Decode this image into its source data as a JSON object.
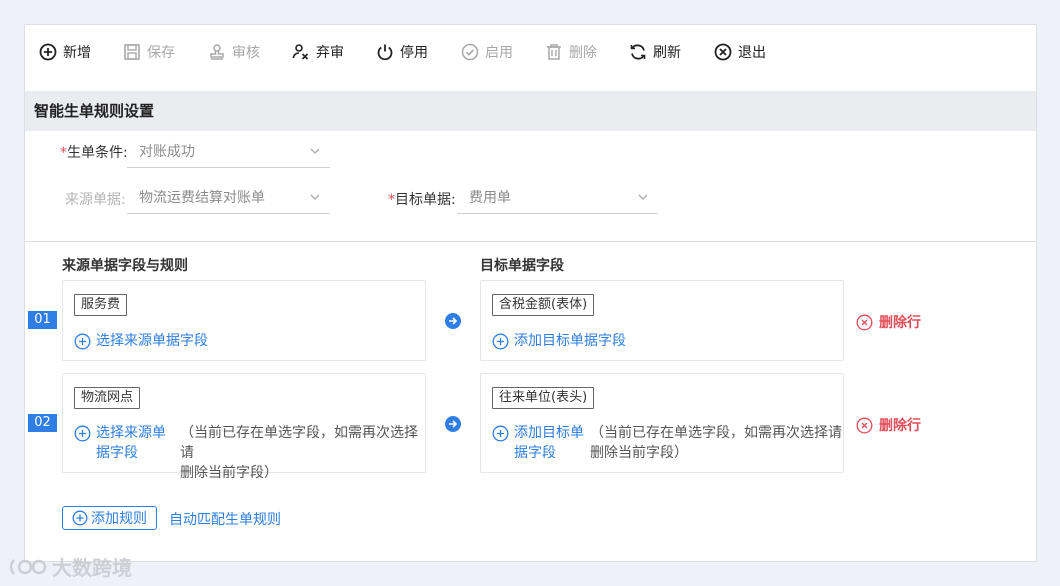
{
  "toolbar": {
    "add": "新增",
    "save": "保存",
    "audit": "审核",
    "unaudit": "弃审",
    "disable": "停用",
    "enable": "启用",
    "delete": "删除",
    "refresh": "刷新",
    "exit": "退出"
  },
  "section": {
    "title": "智能生单规则设置"
  },
  "form": {
    "condition_label": "生单条件:",
    "condition_value": "对账成功",
    "source_label": "来源单据:",
    "source_value": "物流运费结算对账单",
    "target_label": "目标单据:",
    "target_value": "费用单"
  },
  "columns": {
    "source": "来源单据字段与规则",
    "target": "目标单据字段"
  },
  "rows": [
    {
      "num": "01",
      "source_tag": "服务费",
      "source_add": "选择来源单据字段",
      "target_tag": "含税金额(表体)",
      "target_add": "添加目标单据字段",
      "delete": "删除行"
    },
    {
      "num": "02",
      "source_tag": "物流网点",
      "source_add_1": "选择来源单",
      "source_add_2": "据字段",
      "source_hint_1": "（当前已存在单选字段，如需再次选择请",
      "source_hint_2": "删除当前字段）",
      "target_tag": "往来单位(表头)",
      "target_add_1": "添加目标单",
      "target_add_2": "据字段",
      "target_hint_1": "（当前已存在单选字段，如需再次选择请",
      "target_hint_2": "删除当前字段）",
      "delete": "删除行"
    }
  ],
  "footer": {
    "add_rule": "添加规则",
    "auto_match": "自动匹配生单规则"
  },
  "watermark": "大数跨境",
  "colors": {
    "accent": "#2e7ee6",
    "danger": "#e34d59",
    "disabled": "#a8a8a8"
  }
}
